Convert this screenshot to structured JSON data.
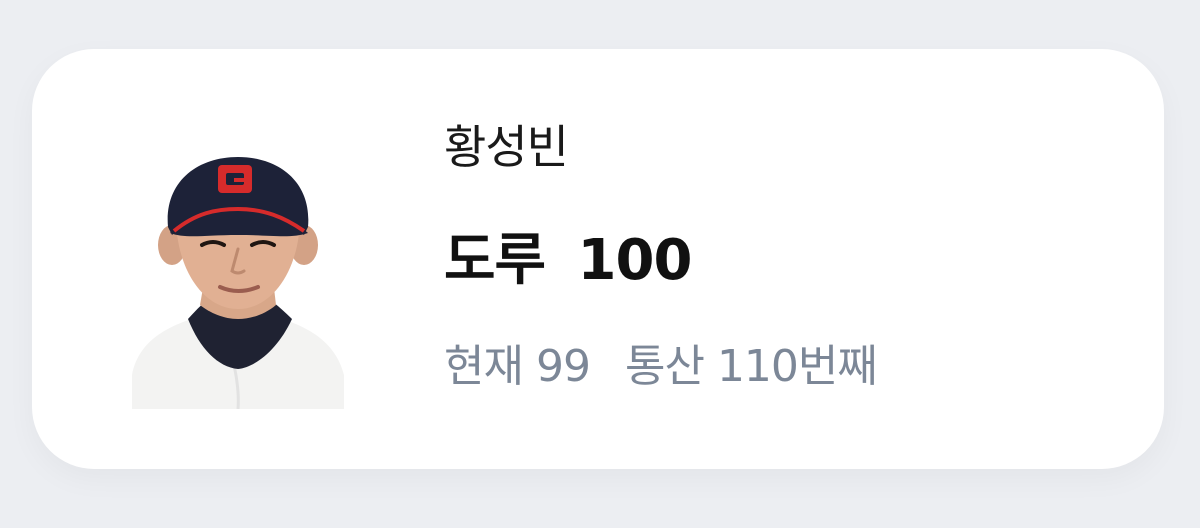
{
  "player": {
    "name": "황성빈",
    "record_stat": "도루",
    "record_value": "100",
    "current_label": "현재",
    "current_value": "99",
    "career_label": "통산",
    "career_value": "110번째"
  },
  "colors": {
    "page_bg": "#eceef2",
    "card_bg": "#ffffff",
    "name": "#1a1a1a",
    "record": "#111111",
    "meta": "#7c8797",
    "cap": "#1d2238",
    "cap_accent": "#d62b2b"
  }
}
